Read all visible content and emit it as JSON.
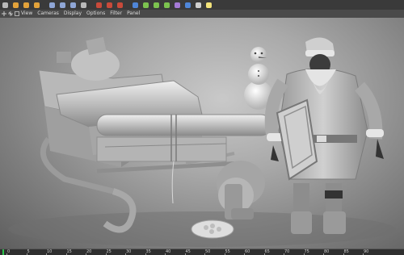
{
  "toolbar": {
    "tools": [
      {
        "name": "undo-icon",
        "color": "#b9b9b9"
      },
      {
        "name": "move-icon",
        "color": "#e2a23a"
      },
      {
        "name": "scale-icon",
        "color": "#e2a23a"
      },
      {
        "name": "rotate-icon",
        "color": "#e2a23a"
      },
      {
        "name": "x-axis-icon",
        "color": "#8fa6d6"
      },
      {
        "name": "y-axis-icon",
        "color": "#8fa6d6"
      },
      {
        "name": "z-axis-icon",
        "color": "#8fa6d6"
      },
      {
        "name": "world-coordinates-icon",
        "color": "#b9b9b9"
      },
      {
        "name": "render-view-icon",
        "color": "#c84a3a"
      },
      {
        "name": "render-picture-viewer-icon",
        "color": "#c84a3a"
      },
      {
        "name": "render-settings-icon",
        "color": "#c84a3a"
      },
      {
        "name": "cube-icon",
        "color": "#4f86d8"
      },
      {
        "name": "spline-icon",
        "color": "#7cc24f"
      },
      {
        "name": "nurbs-icon",
        "color": "#7cc24f"
      },
      {
        "name": "array-icon",
        "color": "#7cc24f"
      },
      {
        "name": "deformer-icon",
        "color": "#a57ad6"
      },
      {
        "name": "floor-icon",
        "color": "#4f86d8"
      },
      {
        "name": "camera-icon",
        "color": "#cfcfcf"
      },
      {
        "name": "light-icon",
        "color": "#f2e27a"
      }
    ]
  },
  "menubar": {
    "items": [
      "View",
      "Cameras",
      "Display",
      "Options",
      "Filter",
      "Panel"
    ]
  },
  "timeline": {
    "ticks": [
      "0",
      "5",
      "10",
      "15",
      "20",
      "25",
      "30",
      "35",
      "40",
      "45",
      "50",
      "55",
      "60",
      "65",
      "70",
      "75",
      "80",
      "85",
      "90"
    ],
    "current_frame": 0
  }
}
